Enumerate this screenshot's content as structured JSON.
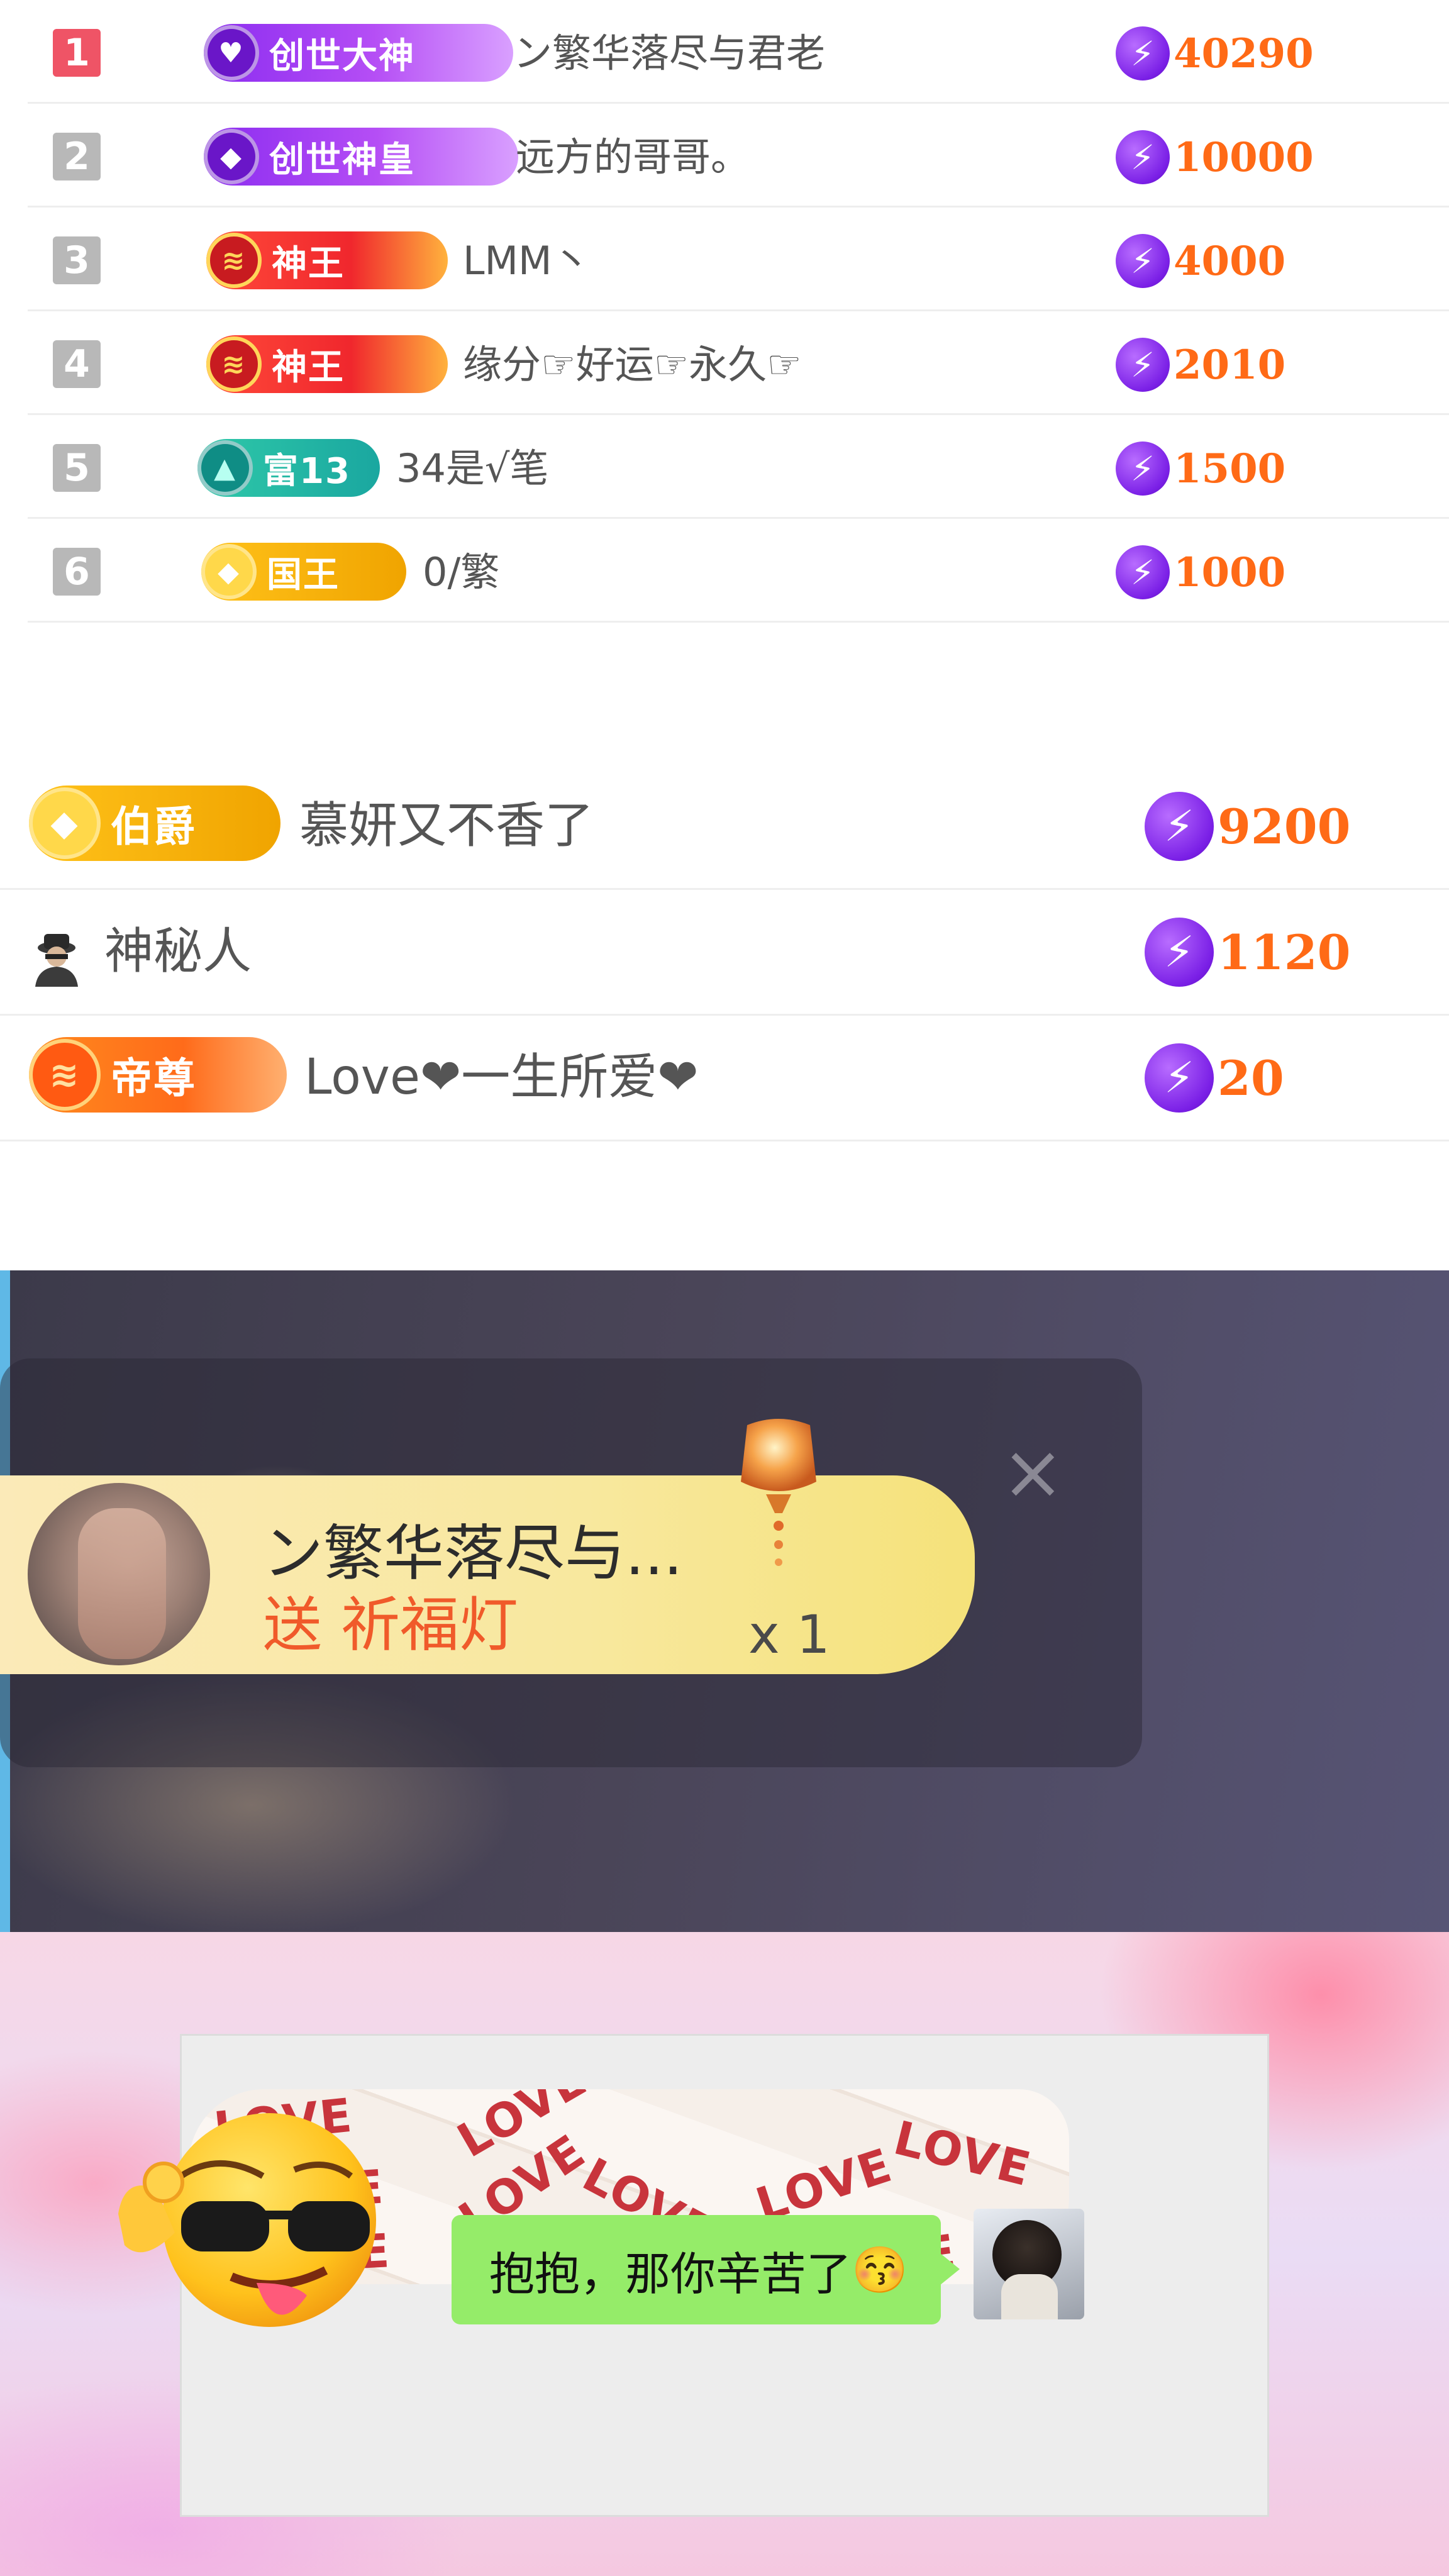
{
  "ranking": [
    {
      "rank": "1",
      "badge": "创世大神",
      "name": "ン繁华落尽与君老",
      "score": "40290"
    },
    {
      "rank": "2",
      "badge": "创世神皇",
      "name": "远方的哥哥。",
      "score": "10000"
    },
    {
      "rank": "3",
      "badge": "神王",
      "name": "LMM丶",
      "score": "4000"
    },
    {
      "rank": "4",
      "badge": "神王",
      "name": "缘分☞好运☞永久☞",
      "score": "2010"
    },
    {
      "rank": "5",
      "badge": "富13",
      "name": "34是√笔",
      "score": "1500"
    },
    {
      "rank": "6",
      "badge": "国王",
      "name": "0/繁",
      "score": "1000"
    }
  ],
  "list2": [
    {
      "badge": "伯爵",
      "name": "慕妍又不香了",
      "score": "9200"
    },
    {
      "badge": "",
      "name": "神秘人",
      "score": "1120"
    },
    {
      "badge": "帝尊",
      "name": "Love❤一生所爱❤",
      "score": "20"
    }
  ],
  "gift": {
    "sender": "ン繁华落尽与...",
    "action": "送 祈福灯",
    "count": "x 1",
    "close": "×"
  },
  "chat": {
    "love_word": "LOVE",
    "bubble_text": "抱抱，那你辛苦了",
    "bubble_emoji": "😚"
  },
  "icons": {
    "bolt": "⚡",
    "spy": "mystery-person-icon"
  },
  "colors": {
    "score": "#ff6a16",
    "rank_first": "#ef5466",
    "rank_other": "#b8b8b8",
    "chat_bubble": "#95ec69"
  }
}
